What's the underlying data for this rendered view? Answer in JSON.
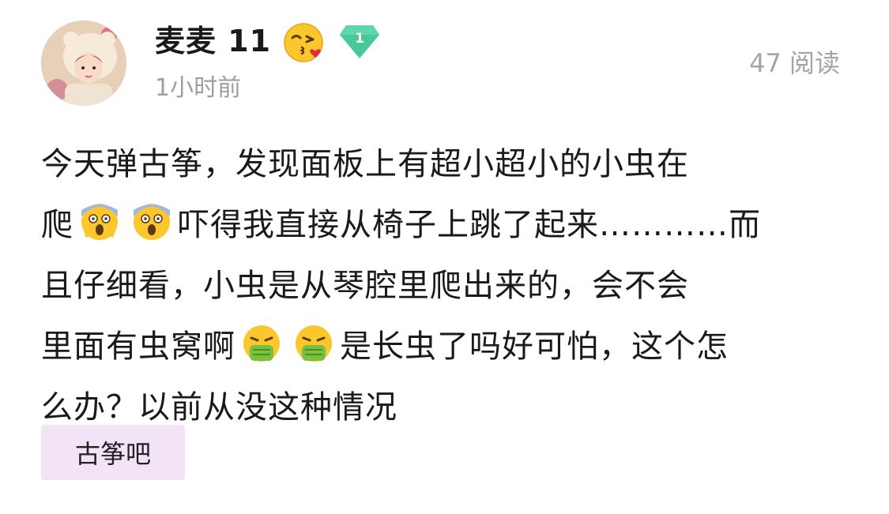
{
  "post": {
    "author": "麦麦 11",
    "time": "1小时前",
    "reads": "47 阅读",
    "level": "1",
    "content": {
      "l1": "今天弹古筝，发现面板上有超小超小的小虫在",
      "l2a": "爬",
      "l2b": "吓得我直接从椅子上跳了起来…………而",
      "l3": "且仔细看，小虫是从琴腔里爬出来的，会不会",
      "l4a": "里面有虫窝啊",
      "l4b": "是长虫了吗好可怕，这个怎",
      "l5": "么办？以前从没这种情况"
    },
    "tag": "古筝吧"
  },
  "colors": {
    "tag_bg": "#f3e3f6",
    "badge": "#49c89a",
    "muted_text": "#9e9e9e"
  },
  "icons": {
    "after_author": "kiss-heart-emoji-icon",
    "badge": "level-diamond-icon",
    "scream": "screaming-fear-emoji-icon",
    "vomit": "vomiting-emoji-icon"
  }
}
